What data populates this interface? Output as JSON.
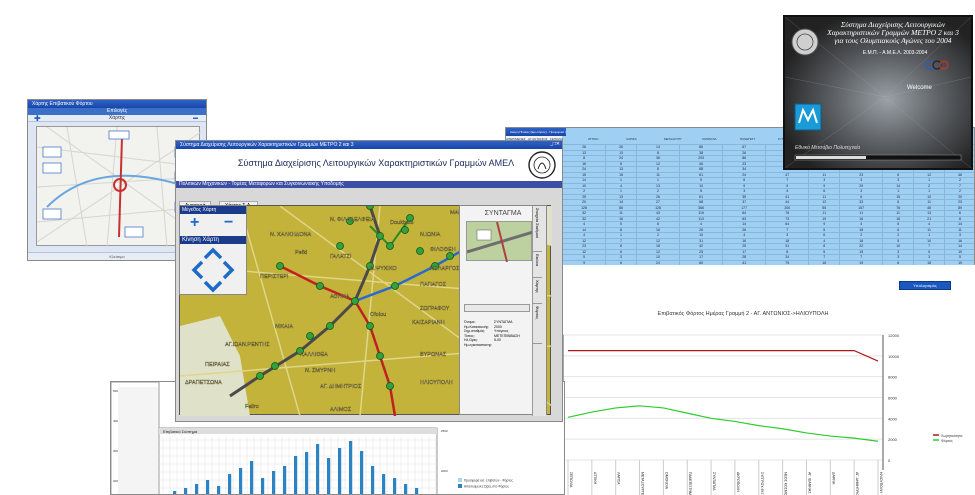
{
  "win1": {
    "title": "Χάρτης Επιβατικού Φόρτου",
    "header": "Επιλογές",
    "subheader": "Χάρτης",
    "footer": "Κλείσιμο"
  },
  "win2": {
    "window_title": "Σύστημα Διαχείρισης Λειτουργικών Χαρακτηριστικών Γραμμών ΜΕΤΡΟ 2 και 3",
    "app_title": "Σύστημα Διαχείρισης Λειτουργικών Χαρακτηριστικών Γραμμών ΑΜΕΛ",
    "subtitle": "Πολιτικών Μηχανικών - Τομέας Μεταφορών και Συγκοινωνιακής Υποδομής",
    "tabs": [
      "Αναφορά",
      "Χάρτης Σ.Α."
    ],
    "controls": {
      "zoom_label": "Μέγεθος Χάρτη",
      "move_label": "Κίνηση Χάρτη",
      "plus": "+",
      "minus": "−"
    },
    "side_title": "ΣΥΝΤΑΓΜΑ",
    "side_tabs": [
      "Στοιχεία Σταθμού",
      "Εικόνα",
      "Χάρτης",
      "Φόρτος"
    ],
    "info": [
      [
        "Όνομα:",
        "ΣΥΝΤΑΓΜΑ"
      ],
      [
        "Ημ.Κατασκευής:",
        "2000"
      ],
      [
        "Σημ.σταθμός:",
        "Υπόγειος"
      ],
      [
        "Τύπος:",
        "ΜΕΤΕΠΙΒΙΒΑΣΗ"
      ],
      [
        "Ηλ.Ωρες:",
        "5-00"
      ],
      [
        "Ημ.εγκαταστασης:",
        ""
      ]
    ],
    "stations": [
      {
        "name": "Ν. ΦΙΛΑΔΕΛΦΕΙΑ"
      },
      {
        "name": "ΜΑΡΟΥΣΙ"
      },
      {
        "name": "Ν.ΙΩΝΙΑ"
      },
      {
        "name": "Ν. ΧΑΛΚΗΔΟΝΑ"
      },
      {
        "name": "ΦΙΛΟΘΕΗ"
      },
      {
        "name": "ΠΕΡΙΣΤΕΡΙ"
      },
      {
        "name": "ΓΑΛΑΤΣΙ"
      },
      {
        "name": "ΧΑΛΑΝΔΡΙ"
      },
      {
        "name": "Ν.ΨΥΧΙΚΟ"
      },
      {
        "name": "ΑΘΗΝΑ"
      },
      {
        "name": "ΠΑΠΑΓΟΣ"
      },
      {
        "name": "ΧΟΛΑΡΓΟΣ"
      },
      {
        "name": "ΖΩΓΡΑΦΟΥ"
      },
      {
        "name": "ΚΑΙΣΑΡΙΑΝΗ"
      },
      {
        "name": "ΝΙΚΑΙΑ"
      },
      {
        "name": "ΑΓ.ΙΩΑΝ.ΡΕΝΤΗΣ"
      },
      {
        "name": "ΠΕΙΡΑΙΑΣ"
      },
      {
        "name": "ΚΑΛΛΙΘΕΑ"
      },
      {
        "name": "Ν. ΣΜΥΡΝΗ"
      },
      {
        "name": "ΒΥΡΩΝΑΣ"
      },
      {
        "name": "ΔΡΑΠΕΤΣΩΝΑ"
      },
      {
        "name": "ΑΓ. ΔΗΜΗΤΡΙΟΣ"
      },
      {
        "name": "ΗΛΙΟΥΠΟΛΗ"
      },
      {
        "name": "ΑΛΙΜΟΣ"
      },
      {
        "name": "Faliro"
      },
      {
        "name": "Doukissis"
      },
      {
        "name": "Pefki"
      },
      {
        "name": "Ofolou"
      }
    ]
  },
  "win3": {
    "title": "Ακόμη Πίνακες (Ερωτήσεις) - Προφορικά (1)",
    "headers": [
      "ΑΠΕΡΙΜΕΝΕΣ",
      "ΑΓ.ΑΝΤΩΝΙΟΣ",
      "ΣΕΠΟΛΙΑ",
      "ΑΤΤΙΚΗ",
      "ΛΑΡΙΣΑ",
      "ΜΕΤΑΞΟΥΡΓ",
      "ΟΜΟΝΟΙΑ",
      "ΠΑΝΕΠΙΣΤ",
      "ΣΥΝΤΑΓΜΑ",
      "ΑΚΡΟΠΟΛΗ",
      "ΣΥΓΓΡΟΥ"
    ],
    "rows": [
      [
        "26",
        "26",
        "14",
        "86",
        "67",
        "95",
        "34",
        "67",
        "",
        "",
        ""
      ],
      [
        "13",
        "13",
        "8",
        "38",
        "26",
        "45",
        "9",
        "26",
        "",
        "",
        ""
      ],
      [
        "8",
        "24",
        "36",
        "203",
        "86",
        "252",
        "24",
        "86",
        "",
        "",
        ""
      ],
      [
        "16",
        "8",
        "12",
        "46",
        "23",
        "27",
        "8",
        "23",
        "",
        "",
        ""
      ],
      [
        "24",
        "13",
        "8",
        "88",
        "34",
        "48",
        "11",
        "23",
        "14",
        "18",
        "26"
      ],
      [
        "15",
        "15",
        "11",
        "61",
        "24",
        "47",
        "11",
        "23",
        "6",
        "12",
        "46"
      ],
      [
        "14",
        "1",
        "1",
        "5",
        "6",
        "7",
        "3",
        "3",
        "3",
        "1",
        "2"
      ],
      [
        "10",
        "4",
        "13",
        "10",
        "9",
        "9",
        "9",
        "29",
        "14",
        "2",
        "7"
      ],
      [
        "2",
        "1",
        "2",
        "5",
        "3",
        "4",
        "6",
        "3",
        "1",
        "1",
        "2"
      ],
      [
        "25",
        "13",
        "26",
        "61",
        "35",
        "41",
        "11",
        "6",
        "15",
        "10",
        "20"
      ],
      [
        "20",
        "14",
        "27",
        "68",
        "37",
        "44",
        "12",
        "33",
        "6",
        "11",
        "23"
      ],
      [
        "128",
        "66",
        "126",
        "366",
        "177",
        "200",
        "55",
        "157",
        "76",
        "46",
        "89"
      ],
      [
        "32",
        "11",
        "43",
        "119",
        "64",
        "76",
        "11",
        "11",
        "11",
        "13",
        "6"
      ],
      [
        "32",
        "16",
        "42",
        "113",
        "63",
        "73",
        "19",
        "16",
        "16",
        "21",
        "8"
      ],
      [
        "4",
        "5",
        "8",
        "4",
        "14",
        "64",
        "9",
        "4",
        "5",
        "4",
        "14"
      ],
      [
        "14",
        "8",
        "16",
        "26",
        "26",
        "7",
        "5",
        "18",
        "6",
        "11",
        "11"
      ],
      [
        "4",
        "1",
        "2",
        "10",
        "4",
        "3",
        "6",
        "2",
        "2",
        "1",
        "3"
      ],
      [
        "12",
        "7",
        "12",
        "31",
        "16",
        "18",
        "4",
        "16",
        "5",
        "10",
        "16"
      ],
      [
        "23",
        "8",
        "18",
        "42",
        "25",
        "31",
        "8",
        "22",
        "10",
        "7",
        "14"
      ],
      [
        "12",
        "6",
        "12",
        "25",
        "17",
        "8",
        "5",
        "15",
        "3",
        "5",
        "10"
      ],
      [
        "5",
        "3",
        "10",
        "17",
        "28",
        "34",
        "7",
        "7",
        "3",
        "3",
        "5"
      ],
      [
        "9",
        "6",
        "24",
        "60",
        "41",
        "79",
        "16",
        "19",
        "6",
        "18",
        "19"
      ]
    ]
  },
  "win4": {
    "title_lines": [
      "Σύστημα Διαχείρισης Λειτουργικών",
      "Χαρακτηριστικών Γραμμών ΜΕΤΡΟ 2 και 3",
      "για τους Ολυμπιακούς Αγώνες του 2004"
    ],
    "org": "Ε.Μ.Π. - Α.Μ.Ε.Λ. 2003-2004",
    "welcome": "Welcome",
    "footer": "Εθνικό Μετσόβιο Πολυτεχνείο"
  },
  "chart_right": {
    "button": "Υπολογισμός",
    "chart_data": {
      "type": "line",
      "title": "Επιβατικός Φόρτος Ημέρας Γραμμή 2 - ΑΓ. ΑΝΤΩΝΙΟΣ->ΗΛΙΟΥΠΟΛΗ",
      "categories": [
        "ΣΕΠΟΛΙΑ",
        "ΑΤΤΙΚΗ",
        "ΛΑΡΙΣΑ",
        "ΜΕΤΑΞΟΥΡΓΕΙΟ",
        "ΟΜΟΝΟΙΑ",
        "ΠΑΝΕΠΙΣΤΗΜΙΟ",
        "ΣΥΝΤΑΓΜΑ",
        "ΑΚΡΟΠΟΛΗ",
        "ΣΥΓΓΡΟΥ-ΦΙΞ",
        "ΝΕΟΣ ΚΟΣΜΟΣ",
        "ΑΓ. ΙΩΑΝΝΗΣ",
        "ΔΑΦΝΗ",
        "ΑΓ. ΔΗΜΗΤΡΙΟΣ",
        "ΗΛΙΟΥΠΟΛΗ"
      ],
      "series": [
        {
          "name": "Χωρητικότητα",
          "color": "#b01818",
          "values": [
            10500,
            10500,
            10500,
            10500,
            10500,
            10500,
            10500,
            10500,
            10500,
            10500,
            10500,
            10500,
            10500,
            9500
          ]
        },
        {
          "name": "Φόρτος",
          "color": "#2ecc2e",
          "values": [
            4100,
            4600,
            5000,
            5200,
            5000,
            4500,
            4000,
            3700,
            3300,
            3000,
            2600,
            2300,
            2100,
            1800
          ]
        }
      ],
      "ylim": [
        0,
        12000
      ],
      "yticks": [
        "0",
        "2000",
        "4000",
        "6000",
        "8000",
        "10000",
        "12000"
      ]
    }
  },
  "chart_left": {
    "title": "Επιβατικό Σύστημα",
    "legend": [
      "Προσφορά εισ. επιβατών - Φόρτος",
      "Απαιτούμενες Ώρες στο Φόρτος"
    ],
    "yticks_left": [
      "500",
      "400",
      "300",
      "200"
    ],
    "yticks_right": [
      "3000",
      "2500",
      "2000"
    ],
    "chart_data": {
      "type": "bar",
      "values": [
        5,
        8,
        12,
        16,
        10,
        22,
        28,
        35,
        18,
        25,
        30,
        40,
        44,
        52,
        38,
        48,
        55,
        45,
        30,
        22,
        18,
        12,
        8
      ]
    }
  }
}
